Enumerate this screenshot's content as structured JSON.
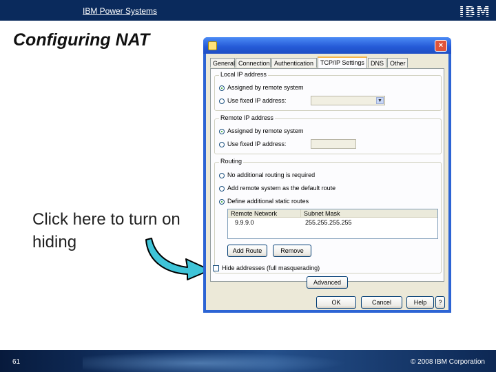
{
  "slide": {
    "header_title": "IBM Power Systems",
    "logo": "IBM",
    "title": "Configuring NAT",
    "callout": "Click here to turn on hiding",
    "page_number": "61",
    "copyright": "© 2008 IBM Corporation"
  },
  "dialog": {
    "tabs": [
      "General",
      "Connection",
      "Authentication",
      "TCP/IP Settings",
      "DNS",
      "Other"
    ],
    "active_tab": "TCP/IP Settings",
    "local_ip": {
      "label": "Local IP address",
      "options": [
        "Assigned by remote system",
        "Use fixed IP address:"
      ],
      "selected": "Assigned by remote system"
    },
    "remote_ip": {
      "label": "Remote IP address",
      "options": [
        "Assigned by remote system",
        "Use fixed IP address:"
      ],
      "selected": "Assigned by remote system"
    },
    "routing": {
      "label": "Routing",
      "options": [
        "No additional routing is required",
        "Add remote system as the default route",
        "Define additional static routes"
      ],
      "selected": "Define additional static routes",
      "table": {
        "columns": [
          "Remote Network",
          "Subnet Mask"
        ],
        "rows": [
          [
            "9.9.9.0",
            "255.255.255.255"
          ]
        ]
      },
      "add_route_label": "Add Route",
      "remove_label": "Remove"
    },
    "hide_addresses_label": "Hide addresses (full masquerading)",
    "hide_addresses_checked": false,
    "advanced_label": "Advanced",
    "ok_label": "OK",
    "cancel_label": "Cancel",
    "help_label": "Help",
    "help_icon": "?",
    "close_icon": "×"
  },
  "colors": {
    "header_bg": "#0a2a5c",
    "dialog_titlebar": "#2459d6",
    "arrow_fill": "#3fc4d8"
  }
}
